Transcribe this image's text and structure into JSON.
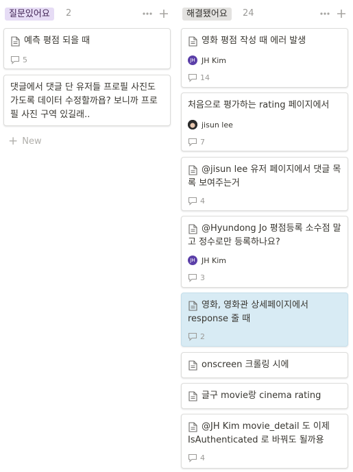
{
  "columns": {
    "left": {
      "title": "질문있어요",
      "count": "2",
      "new_label": "New",
      "cards": [
        {
          "title": "예측 평점 되을 때",
          "comments": "5"
        },
        {
          "title": "댓글에서 댓글 단 유저들 프로필 사진도 가도록 데이터 수정할까욥? 보니까 프로필 사진 구역 있길래.."
        }
      ]
    },
    "right": {
      "title": "해결됐어요",
      "count": "24",
      "cards": [
        {
          "title": "영화 평점 작성 때 에러 발생",
          "person": "JH Kim",
          "avatar": "JH",
          "comments": "14"
        },
        {
          "title": "처음으로 평가하는 rating 페이지에서",
          "person": "jisun lee",
          "comments": "7"
        },
        {
          "title": "@jisun lee 유저 페이지에서 댓글 목록 보여주는거",
          "comments": "4"
        },
        {
          "title": "@Hyundong Jo 평점등록 소수점 말고 정수로만 등록하나요?",
          "person": "JH Kim",
          "avatar": "JH",
          "comments": "3"
        },
        {
          "title": "영화, 영화관 상세페이지에서 response 줄 때",
          "comments": "2"
        },
        {
          "title": "onscreen 크롤링 시에"
        },
        {
          "title": "글구 movie랑 cinema rating"
        },
        {
          "title": "@JH Kim  movie_detail 도 이제 IsAuthenticated 로 바꿔도 될까용",
          "comments": "4"
        }
      ]
    }
  },
  "colors": {
    "badge_purple": "#e6dcf5",
    "badge_gray": "#e3e2e0",
    "highlight_card": "#d8ebf4",
    "avatar_jh": "#5b3fa8"
  }
}
